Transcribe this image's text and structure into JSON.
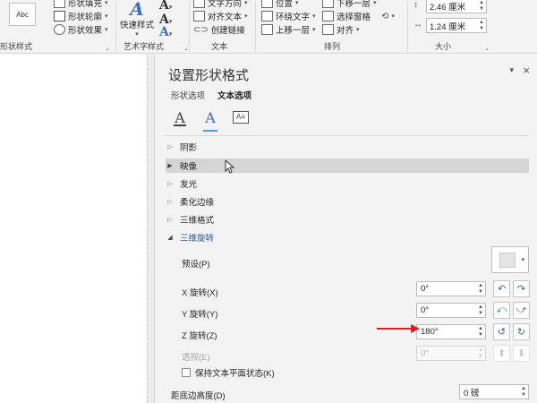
{
  "ribbon": {
    "shape_styles": {
      "sample_label": "Abc",
      "fill_label": "形状填充",
      "outline_label": "形状轮廓",
      "effects_label": "形状效果",
      "group_label": "形状样式"
    },
    "wordart": {
      "quick_styles_label": "快速样式",
      "group_label": "艺术字样式"
    },
    "text": {
      "direction_label": "文字方向",
      "align_label": "对齐文本",
      "link_label": "创建链接",
      "group_label": "文本"
    },
    "arrange": {
      "position_label": "位置",
      "wrap_label": "环绕文字",
      "forward_label": "上移一层",
      "backward_label": "下移一层",
      "selection_label": "选择窗格",
      "align_label": "对齐",
      "group_label": "排列"
    },
    "size": {
      "height_value": "2.46 厘米",
      "width_value": "1.24 厘米",
      "group_label": "大小"
    }
  },
  "pane": {
    "title": "设置形状格式",
    "tabs": [
      "形状选项",
      "文本选项"
    ],
    "active_tab": "文本选项",
    "subtab_icons": [
      "text-fill-outline-icon",
      "text-effects-icon",
      "textbox-icon"
    ],
    "sections": {
      "shadow": "阴影",
      "reflection": "映像",
      "glow": "发光",
      "soft_edges": "柔化边缘",
      "format_3d": "三维格式",
      "rotation_3d": "三维旋转"
    },
    "rotation": {
      "preset_label": "预设(P)",
      "x_label": "X 旋转(X)",
      "x_value": "0°",
      "y_label": "Y 旋转(Y)",
      "y_value": "0°",
      "z_label": "Z 旋转(Z)",
      "z_value": "180°",
      "perspective_label": "透视(E)",
      "perspective_value": "0°",
      "keep_flat_label": "保持文本平面状态(K)",
      "distance_label": "距底边高度(D)",
      "distance_value": "0 磅"
    }
  },
  "colors": {
    "accent": "#2b579a",
    "annotation_red": "#e02020",
    "pane_bg": "#f3f3f3",
    "highlight_row": "#d5d5d5"
  }
}
